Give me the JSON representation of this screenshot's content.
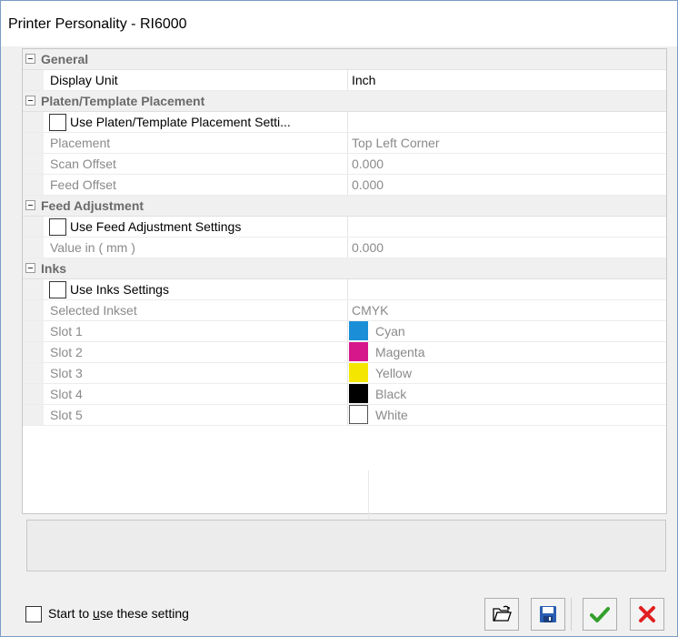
{
  "window": {
    "title": "Printer Personality - RI6000"
  },
  "grid": {
    "rows": [
      {
        "kind": "category",
        "label": "General"
      },
      {
        "kind": "prop",
        "name": "Display Unit",
        "value": "Inch",
        "enabled": true
      },
      {
        "kind": "category",
        "label": "Platen/Template Placement"
      },
      {
        "kind": "checkbox",
        "name": "Use Platen/Template Placement Setti...",
        "checked": false
      },
      {
        "kind": "prop",
        "name": "Placement",
        "value": "Top Left Corner",
        "enabled": false
      },
      {
        "kind": "prop",
        "name": "Scan Offset",
        "value": "0.000",
        "enabled": false
      },
      {
        "kind": "prop",
        "name": "Feed Offset",
        "value": "0.000",
        "enabled": false
      },
      {
        "kind": "category",
        "label": "Feed Adjustment"
      },
      {
        "kind": "checkbox",
        "name": "Use Feed Adjustment Settings",
        "checked": false
      },
      {
        "kind": "prop",
        "name": "Value in ( mm )",
        "value": "0.000",
        "enabled": false
      },
      {
        "kind": "category",
        "label": "Inks"
      },
      {
        "kind": "checkbox",
        "name": "Use Inks Settings",
        "checked": false
      },
      {
        "kind": "prop",
        "name": "Selected Inkset",
        "value": "CMYK",
        "enabled": false
      },
      {
        "kind": "slot",
        "name": "Slot 1",
        "value": "Cyan",
        "color": "#1a8fd8"
      },
      {
        "kind": "slot",
        "name": "Slot 2",
        "value": "Magenta",
        "color": "#d6178c"
      },
      {
        "kind": "slot",
        "name": "Slot 3",
        "value": "Yellow",
        "color": "#f5e600"
      },
      {
        "kind": "slot",
        "name": "Slot 4",
        "value": "Black",
        "color": "#000000"
      },
      {
        "kind": "slot",
        "name": "Slot 5",
        "value": "White",
        "color": "#ffffff"
      }
    ]
  },
  "footer": {
    "start_label_pre": "Start to ",
    "start_label_u": "u",
    "start_label_post": "se these setting",
    "buttons": {
      "open": "open-folder-icon",
      "save": "save-disk-icon",
      "ok": "checkmark-icon",
      "cancel": "close-x-icon"
    }
  },
  "colors": {
    "ok": "#34a02c",
    "cancel": "#e02020",
    "save": "#2a5db0",
    "disabled_text": "#8a8a8a"
  }
}
